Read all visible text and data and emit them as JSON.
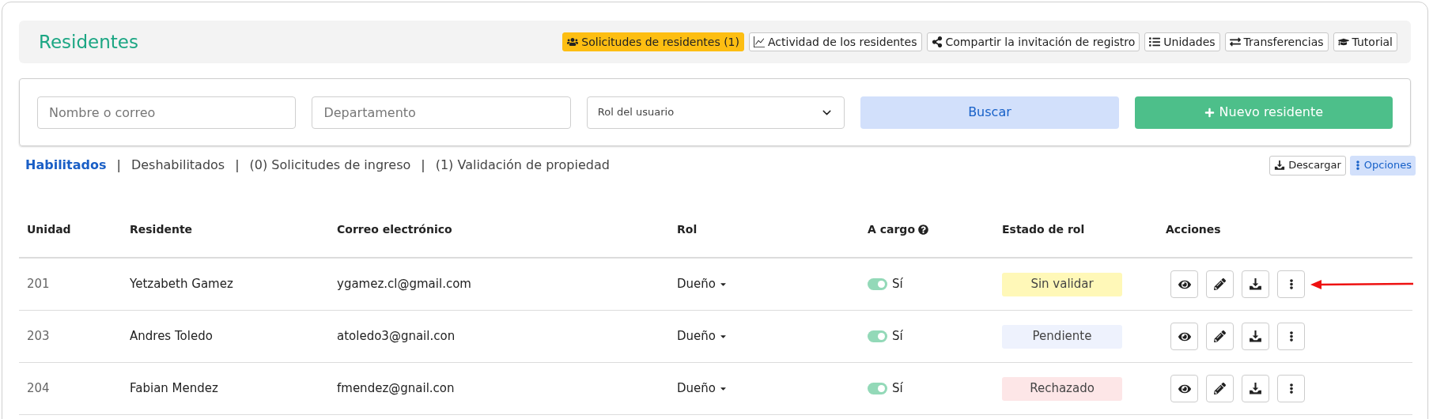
{
  "header": {
    "title": "Residentes",
    "buttons": [
      {
        "label": "Solicitudes de residentes (1)",
        "kind": "users",
        "highlighted": true
      },
      {
        "label": "Actividad de los residentes",
        "kind": "chart",
        "highlighted": false
      },
      {
        "label": "Compartir la invitación de registro",
        "kind": "share",
        "highlighted": false
      },
      {
        "label": "Unidades",
        "kind": "list",
        "highlighted": false
      },
      {
        "label": "Transferencias",
        "kind": "transfer",
        "highlighted": false
      },
      {
        "label": "Tutorial",
        "kind": "tutorial",
        "highlighted": false
      }
    ]
  },
  "filters": {
    "name": {
      "placeholder": "Nombre o correo"
    },
    "department": {
      "placeholder": "Departamento"
    },
    "role": {
      "value": "Rol del usuario"
    },
    "search_button": "Buscar",
    "new_button": "Nuevo residente"
  },
  "tabs": {
    "separator": "|",
    "items": [
      {
        "label": "Habilitados",
        "selected": true
      },
      {
        "label": "Deshabilitados",
        "selected": false
      },
      {
        "label": "(0) Solicitudes de ingreso",
        "selected": false
      },
      {
        "label": "(1) Validación de propiedad",
        "selected": false
      }
    ]
  },
  "toolbar": {
    "download": "Descargar",
    "options": "Opciones"
  },
  "table": {
    "columns": [
      "Unidad",
      "Residente",
      "Correo electrónico",
      "Rol",
      "A cargo",
      "Estado de rol",
      "Acciones"
    ],
    "rows": [
      {
        "unit": "201",
        "resident": "Yetzabeth Gamez",
        "email": "ygamez.cl@gmail.com",
        "role": "Dueño",
        "in_charge": {
          "on": true,
          "label": "Sí"
        },
        "status": {
          "label": "Sin validar",
          "color": "#fff8b8"
        },
        "annotated": true
      },
      {
        "unit": "203",
        "resident": "Andres Toledo",
        "email": "atoledo3@gnail.con",
        "role": "Dueño",
        "in_charge": {
          "on": true,
          "label": "Sí"
        },
        "status": {
          "label": "Pendiente",
          "color": "#eef2fd"
        },
        "annotated": false
      },
      {
        "unit": "204",
        "resident": "Fabian Mendez",
        "email": "fmendez@gnail.con",
        "role": "Dueño",
        "in_charge": {
          "on": true,
          "label": "Sí"
        },
        "status": {
          "label": "Rechazado",
          "color": "#fde6e7"
        },
        "annotated": false
      }
    ]
  }
}
